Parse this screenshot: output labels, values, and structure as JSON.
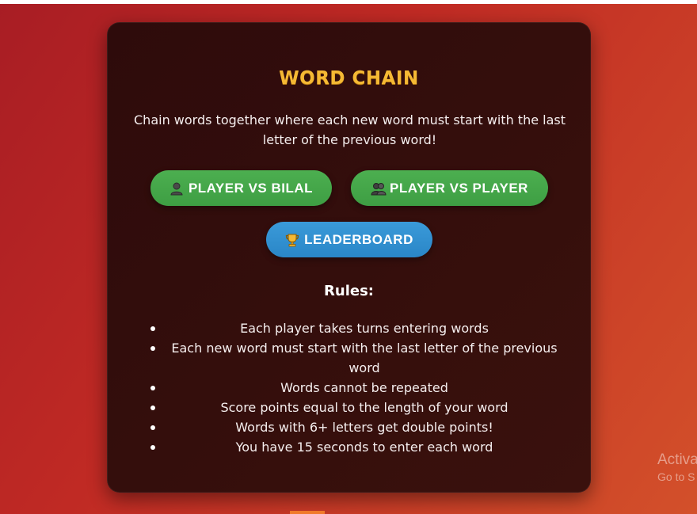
{
  "game": {
    "title": "WORD CHAIN",
    "subtitle": "Chain words together where each new word must start with the last letter of the previous word!",
    "accent_color": "#f5b934"
  },
  "buttons": {
    "player_vs_bilal": {
      "label": "PLAYER VS BILAL",
      "icon": "person-icon",
      "color": "#4caf50"
    },
    "player_vs_player": {
      "label": "PLAYER VS PLAYER",
      "icon": "two-people-icon",
      "color": "#4caf50"
    },
    "leaderboard": {
      "label": "LEADERBOARD",
      "icon": "trophy-icon",
      "color": "#3a9ad9"
    }
  },
  "rules": {
    "heading": "Rules:",
    "items": [
      "Each player takes turns entering words",
      "Each new word must start with the last letter of the previous word",
      "Words cannot be repeated",
      "Score points equal to the length of your word",
      "Words with 6+ letters get double points!",
      "You have 15 seconds to enter each word"
    ]
  },
  "watermark": {
    "line1": "Activa",
    "line2": "Go to S"
  }
}
